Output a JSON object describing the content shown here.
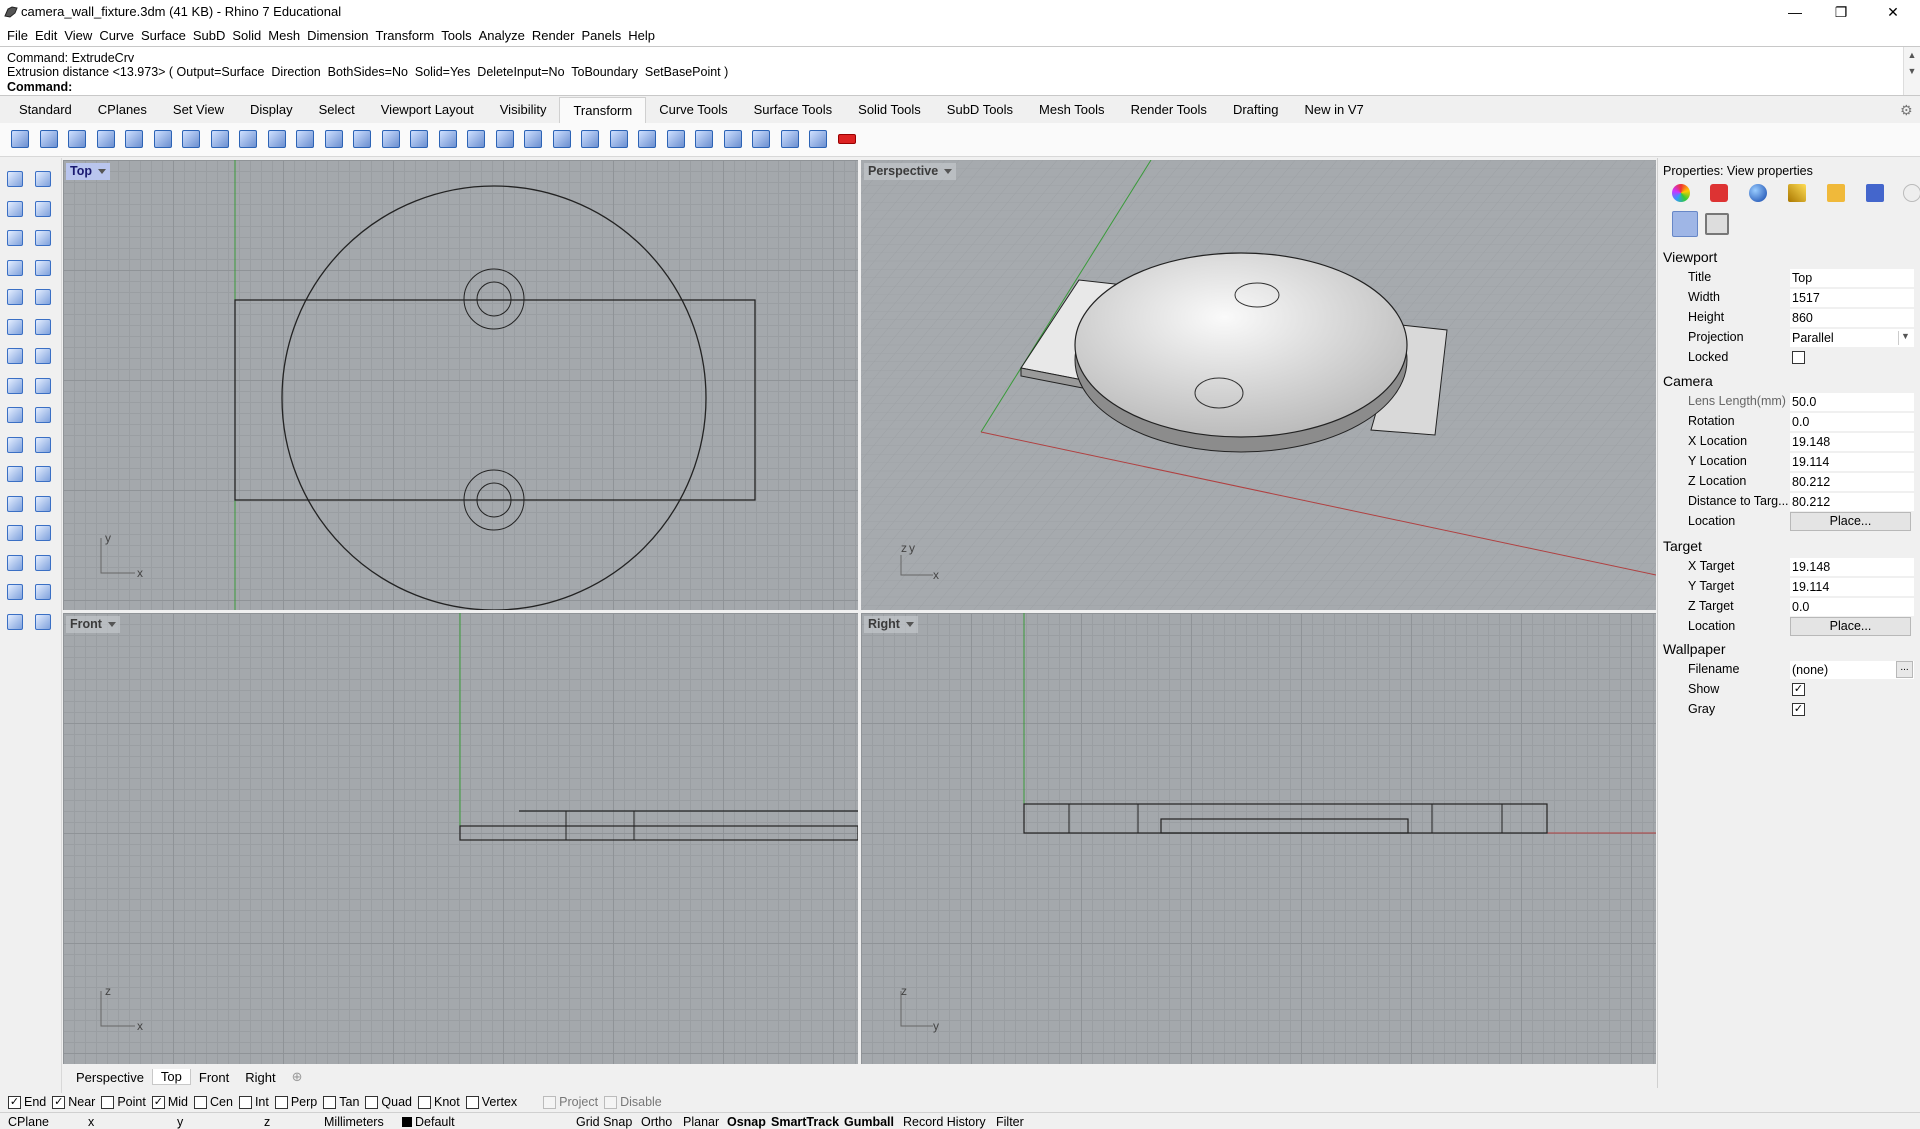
{
  "window": {
    "title": "camera_wall_fixture.3dm (41 KB) - Rhino 7 Educational",
    "minimize_glyph": "—",
    "restore_glyph": "❐",
    "close_glyph": "✕"
  },
  "menu": [
    "File",
    "Edit",
    "View",
    "Curve",
    "Surface",
    "SubD",
    "Solid",
    "Mesh",
    "Dimension",
    "Transform",
    "Tools",
    "Analyze",
    "Render",
    "Panels",
    "Help"
  ],
  "command": {
    "history_1": "Command: ExtrudeCrv",
    "history_2": "Extrusion distance <13.973> ( Output=Surface  Direction  BothSides=No  Solid=Yes  DeleteInput=No  ToBoundary  SetBasePoint )",
    "prompt": "Command:"
  },
  "toolbar_tabs": [
    "Standard",
    "CPlanes",
    "Set View",
    "Display",
    "Select",
    "Viewport Layout",
    "Visibility",
    "Transform",
    "Curve Tools",
    "Surface Tools",
    "Solid Tools",
    "SubD Tools",
    "Mesh Tools",
    "Render Tools",
    "Drafting",
    "New in V7"
  ],
  "active_toolbar_tab": "Transform",
  "viewports": {
    "top": {
      "label": "Top",
      "axis_a": "y",
      "axis_b": "x"
    },
    "perspective": {
      "label": "Perspective",
      "axis_a": "z",
      "axis_b": "y",
      "axis_c": "x"
    },
    "front": {
      "label": "Front",
      "axis_a": "z",
      "axis_b": "x"
    },
    "right": {
      "label": "Right",
      "axis_a": "z",
      "axis_b": "y"
    }
  },
  "viewport_tabs": [
    "Perspective",
    "Top",
    "Front",
    "Right"
  ],
  "viewport_tab_add": "⊕",
  "panel": {
    "title": "Properties: View properties",
    "sections": {
      "viewport": "Viewport",
      "camera": "Camera",
      "target": "Target",
      "wallpaper": "Wallpaper"
    },
    "viewport_rows": [
      {
        "label": "Title",
        "value": "Top"
      },
      {
        "label": "Width",
        "value": "1517"
      },
      {
        "label": "Height",
        "value": "860"
      },
      {
        "label": "Projection",
        "value": "Parallel"
      },
      {
        "label": "Locked",
        "value": ""
      }
    ],
    "camera_rows": [
      {
        "label": "Lens Length(mm)",
        "value": "50.0"
      },
      {
        "label": "Rotation",
        "value": "0.0"
      },
      {
        "label": "X Location",
        "value": "19.148"
      },
      {
        "label": "Y Location",
        "value": "19.114"
      },
      {
        "label": "Z Location",
        "value": "80.212"
      },
      {
        "label": "Distance to Targ...",
        "value": "80.212"
      },
      {
        "label": "Location",
        "value": "Place..."
      }
    ],
    "target_rows": [
      {
        "label": "X Target",
        "value": "19.148"
      },
      {
        "label": "Y Target",
        "value": "19.114"
      },
      {
        "label": "Z Target",
        "value": "0.0"
      },
      {
        "label": "Location",
        "value": "Place..."
      }
    ],
    "wallpaper_rows": [
      {
        "label": "Filename",
        "value": "(none)"
      },
      {
        "label": "Show",
        "value": "checked"
      },
      {
        "label": "Gray",
        "value": "checked"
      }
    ],
    "check_glyph": "✓",
    "dots": "..."
  },
  "osnaps": [
    {
      "label": "End",
      "checked": true
    },
    {
      "label": "Near",
      "checked": true
    },
    {
      "label": "Point",
      "checked": false
    },
    {
      "label": "Mid",
      "checked": true
    },
    {
      "label": "Cen",
      "checked": false
    },
    {
      "label": "Int",
      "checked": false
    },
    {
      "label": "Perp",
      "checked": false
    },
    {
      "label": "Tan",
      "checked": false
    },
    {
      "label": "Quad",
      "checked": false
    },
    {
      "label": "Knot",
      "checked": false
    },
    {
      "label": "Vertex",
      "checked": false
    },
    {
      "label": "Project",
      "checked": false,
      "disabled": true
    },
    {
      "label": "Disable",
      "checked": false,
      "disabled": true
    }
  ],
  "status": {
    "cplane": "CPlane",
    "x": "x",
    "y": "y",
    "z": "z",
    "units": "Millimeters",
    "layer": "Default",
    "grid_snap": "Grid Snap",
    "ortho": "Ortho",
    "planar": "Planar",
    "osnap": "Osnap",
    "smarttrack": "SmartTrack",
    "gumball": "Gumball",
    "record_history": "Record History",
    "filter": "Filter"
  },
  "colors": {
    "viewport_bg": "#a4a8ac",
    "x_axis": "#b04040",
    "y_axis": "#3a9a3a",
    "active_label": "#b9c5ee"
  }
}
